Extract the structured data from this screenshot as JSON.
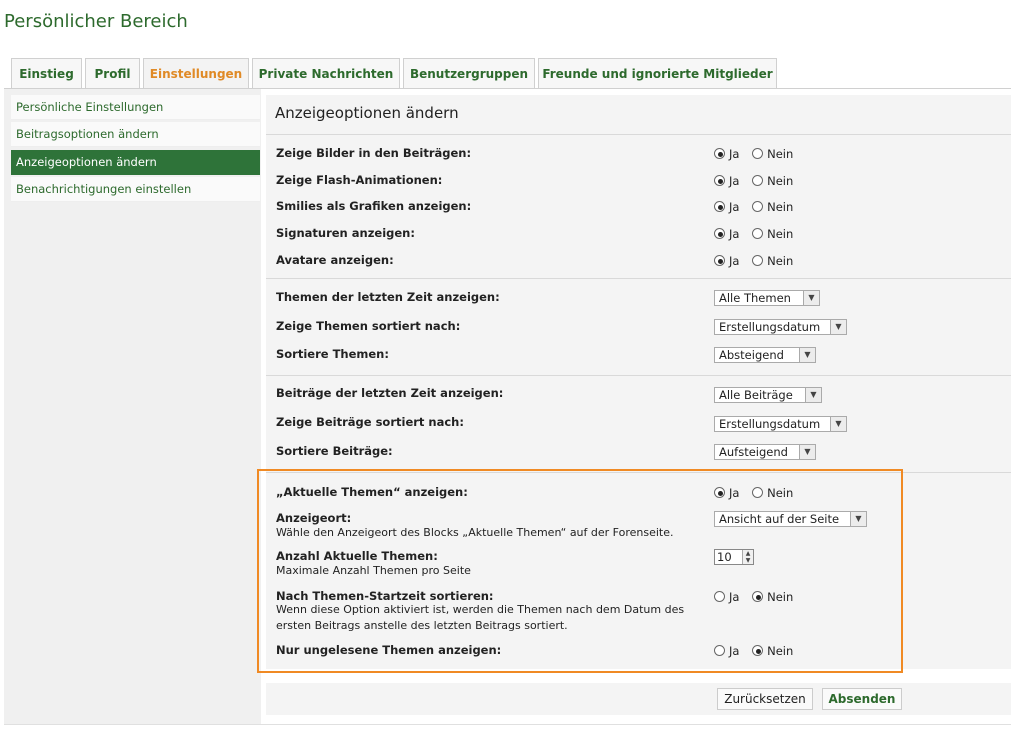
{
  "page_title": "Persönlicher Bereich",
  "tabs": [
    {
      "label": "Einstieg"
    },
    {
      "label": "Profil"
    },
    {
      "label": "Einstellungen",
      "active": true
    },
    {
      "label": "Private Nachrichten"
    },
    {
      "label": "Benutzergruppen"
    },
    {
      "label": "Freunde und ignorierte Mitglieder"
    }
  ],
  "sidebar": {
    "items": [
      {
        "label": "Persönliche Einstellungen"
      },
      {
        "label": "Beitragsoptionen ändern"
      },
      {
        "label": "Anzeigeoptionen ändern",
        "active": true
      },
      {
        "label": "Benachrichtigungen einstellen"
      }
    ]
  },
  "main": {
    "title": "Anzeigeoptionen ändern",
    "yes_label": "Ja",
    "no_label": "Nein",
    "section1": [
      {
        "label": "Zeige Bilder in den Beiträgen:",
        "value": "Ja"
      },
      {
        "label": "Zeige Flash-Animationen:",
        "value": "Ja"
      },
      {
        "label": "Smilies als Grafiken anzeigen:",
        "value": "Ja"
      },
      {
        "label": "Signaturen anzeigen:",
        "value": "Ja"
      },
      {
        "label": "Avatare anzeigen:",
        "value": "Ja"
      }
    ],
    "section2": [
      {
        "label": "Themen der letzten Zeit anzeigen:",
        "value": "Alle Themen"
      },
      {
        "label": "Zeige Themen sortiert nach:",
        "value": "Erstellungsdatum"
      },
      {
        "label": "Sortiere Themen:",
        "value": "Absteigend"
      }
    ],
    "section3": [
      {
        "label": "Beiträge der letzten Zeit anzeigen:",
        "value": "Alle Beiträge"
      },
      {
        "label": "Zeige Beiträge sortiert nach:",
        "value": "Erstellungsdatum"
      },
      {
        "label": "Sortiere Beiträge:",
        "value": "Aufsteigend"
      }
    ],
    "section4": {
      "aktuelle_themen": {
        "label": "„Aktuelle Themen“ anzeigen:",
        "value": "Ja"
      },
      "anzeigeort": {
        "label": "Anzeigeort:",
        "desc": "Wähle den Anzeigeort des Blocks „Aktuelle Themen“ auf der Forenseite.",
        "value": "Ansicht auf der Seite"
      },
      "anzahl": {
        "label": "Anzahl Aktuelle Themen:",
        "desc": "Maximale Anzahl Themen pro Seite",
        "value": "10"
      },
      "startzeit": {
        "label": "Nach Themen-Startzeit sortieren:",
        "desc": "Wenn diese Option aktiviert ist, werden die Themen nach dem Datum des ersten Beitrags anstelle des letzten Beitrags sortiert.",
        "value": "Nein"
      },
      "ungelesen": {
        "label": "Nur ungelesene Themen anzeigen:",
        "value": "Nein"
      }
    }
  },
  "buttons": {
    "reset": "Zurücksetzen",
    "submit": "Absenden"
  },
  "colors": {
    "accent_green": "#2e7339",
    "highlight_orange": "#f08a24",
    "active_tab": "#e08a26"
  }
}
